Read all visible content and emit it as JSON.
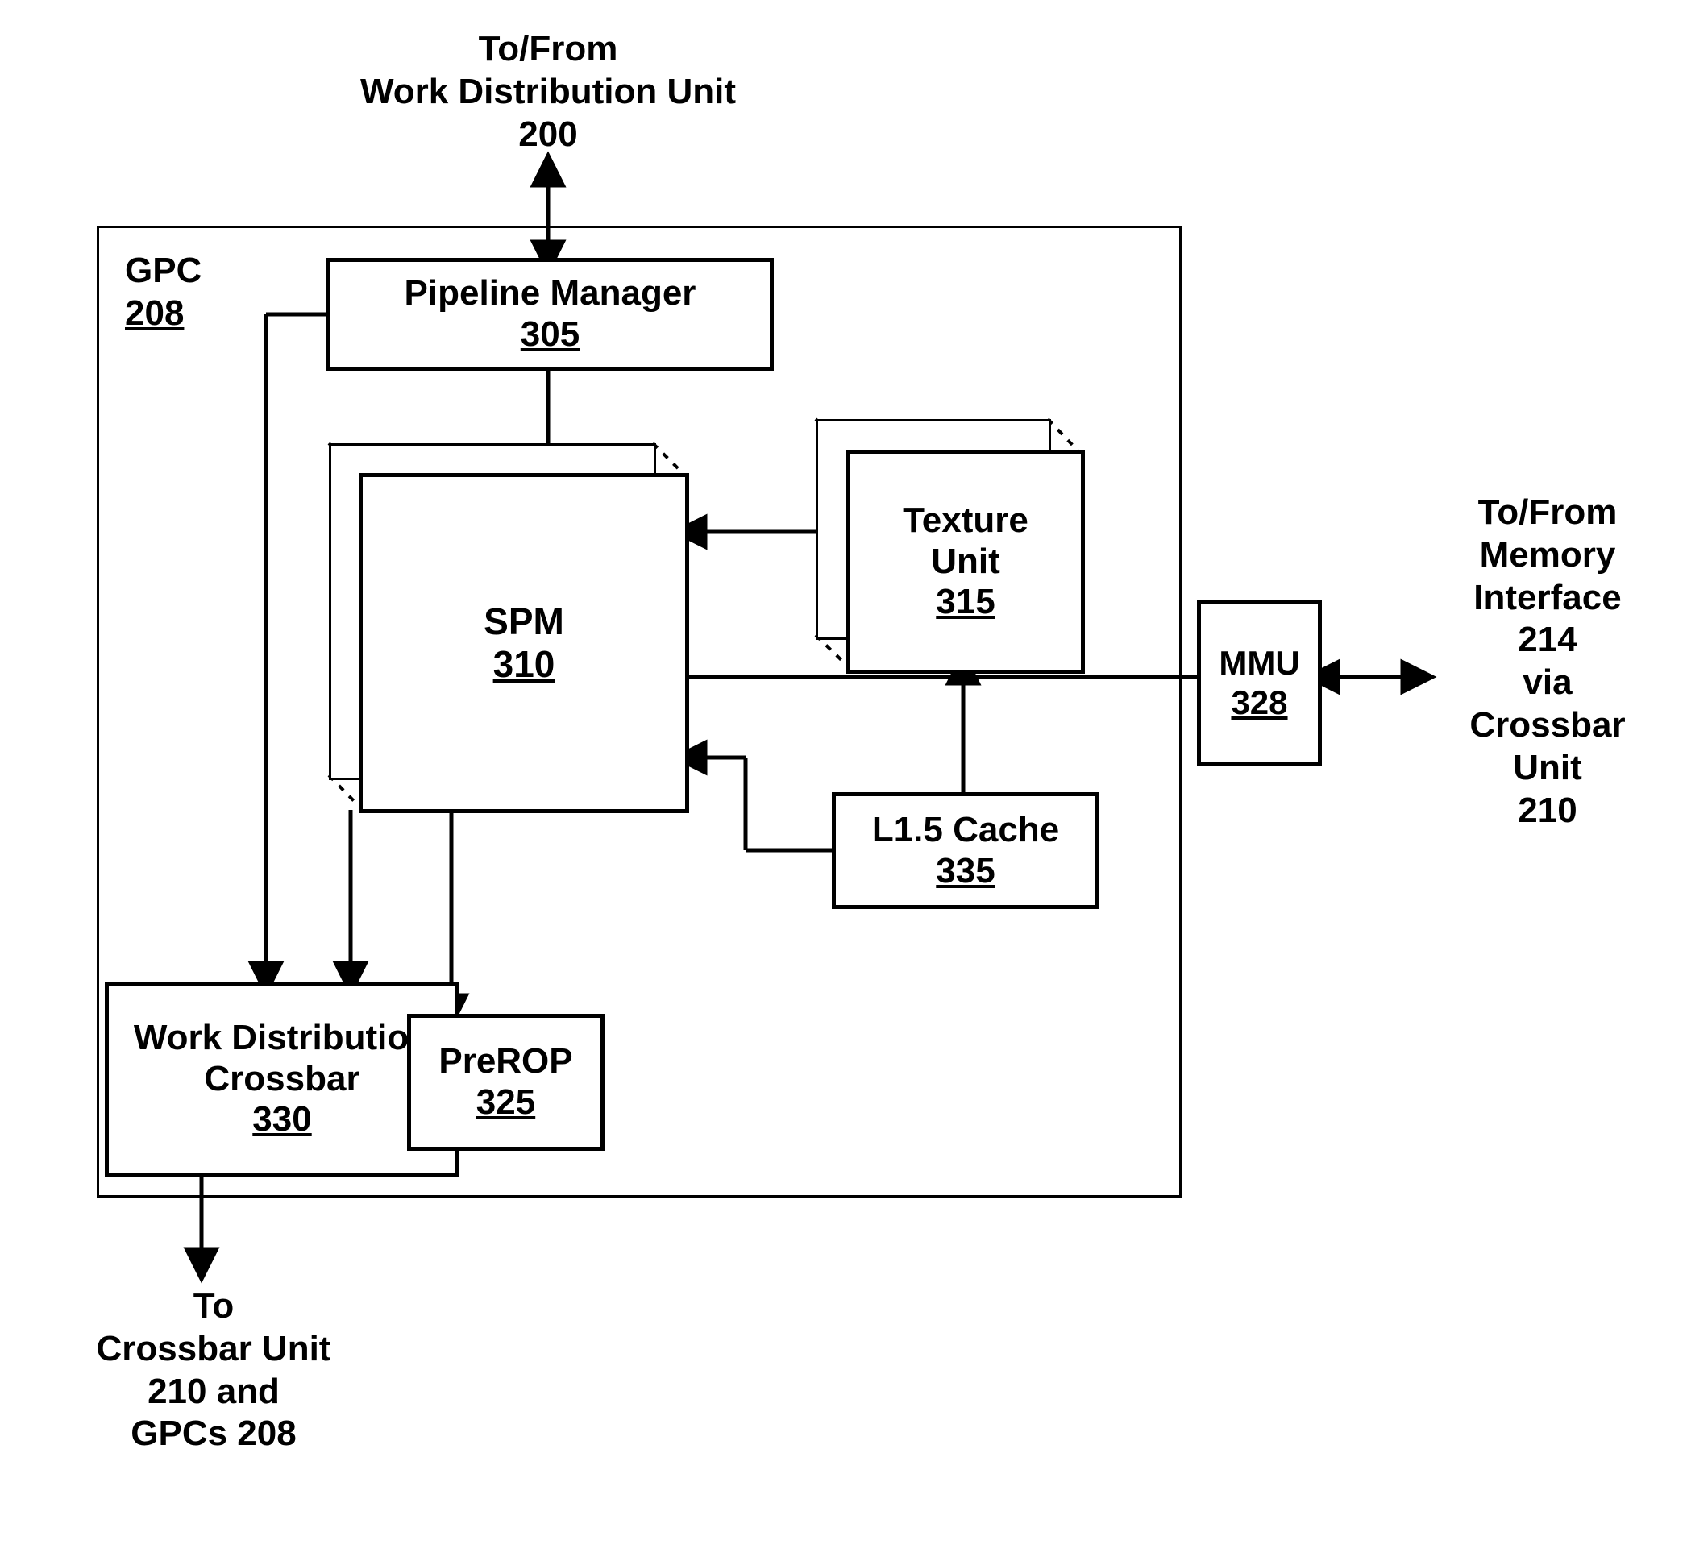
{
  "top_label": {
    "line1": "To/From",
    "line2": "Work Distribution Unit",
    "line3": "200"
  },
  "gpc": {
    "name": "GPC",
    "num": "208"
  },
  "pipeline_manager": {
    "name": "Pipeline Manager",
    "num": "305"
  },
  "spm": {
    "name": "SPM",
    "num": "310"
  },
  "texture_unit": {
    "line1": "Texture",
    "line2": "Unit",
    "num": "315"
  },
  "l15_cache": {
    "name": "L1.5 Cache",
    "num": "335"
  },
  "mmu": {
    "name": "MMU",
    "num": "328"
  },
  "wdx": {
    "line1": "Work Distribution",
    "line2": "Crossbar",
    "num": "330"
  },
  "prerop": {
    "name": "PreROP",
    "num": "325"
  },
  "right_label": {
    "line1": "To/From",
    "line2": "Memory",
    "line3": "Interface",
    "line4": "214",
    "line5": "via",
    "line6": "Crossbar",
    "line7": "Unit",
    "line8": "210"
  },
  "bottom_label": {
    "line1": "To",
    "line2": "Crossbar Unit",
    "line3": "210 and",
    "line4": "GPCs 208"
  }
}
